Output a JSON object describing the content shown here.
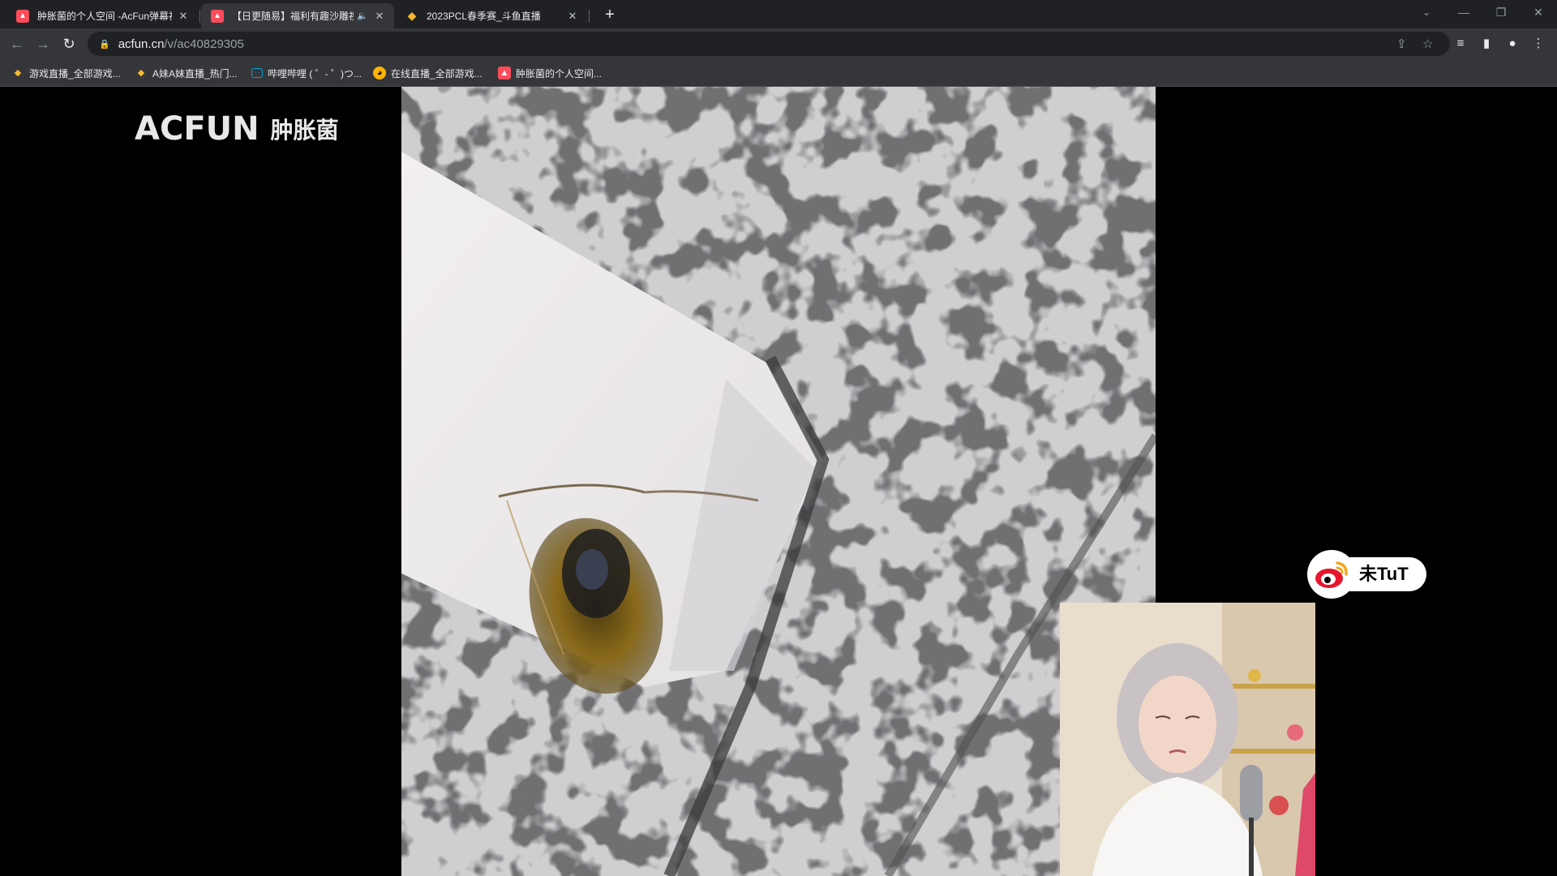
{
  "browser": {
    "tabs": [
      {
        "title": "肿胀菌的个人空间 -AcFun弹幕视频网",
        "active": false,
        "favicon": "acfun-icon"
      },
      {
        "title": "【日更随易】福利有趣沙雕视频",
        "active": true,
        "favicon": "acfun-icon",
        "audio": true
      },
      {
        "title": "2023PCL春季赛_斗鱼直播",
        "active": false,
        "favicon": "douyu-icon"
      }
    ],
    "new_tab_label": "+",
    "address": {
      "domain": "acfun.cn",
      "path": "/v/ac40829305"
    },
    "bookmarks": [
      {
        "label": "游戏直播_全部游戏...",
        "icon": "douyu-icon"
      },
      {
        "label": "A妹A妹直播_热门...",
        "icon": "douyu-icon"
      },
      {
        "label": "哔哩哔哩 ( ゜- ゜)つ...",
        "icon": "bilibili-icon"
      },
      {
        "label": "在线直播_全部游戏...",
        "icon": "huya-icon"
      },
      {
        "label": "肿胀菌的个人空间...",
        "icon": "acfun-icon"
      }
    ]
  },
  "page": {
    "logo": {
      "brand": "ACFUN",
      "sub": "肿胀菌"
    },
    "weibo_badge": {
      "icon": "weibo-icon",
      "text": "未TuT"
    }
  },
  "colors": {
    "tabstrip": "#202124",
    "toolbar": "#35363a",
    "acfun_red": "#fd4c5b",
    "weibo_red": "#e6162d"
  }
}
